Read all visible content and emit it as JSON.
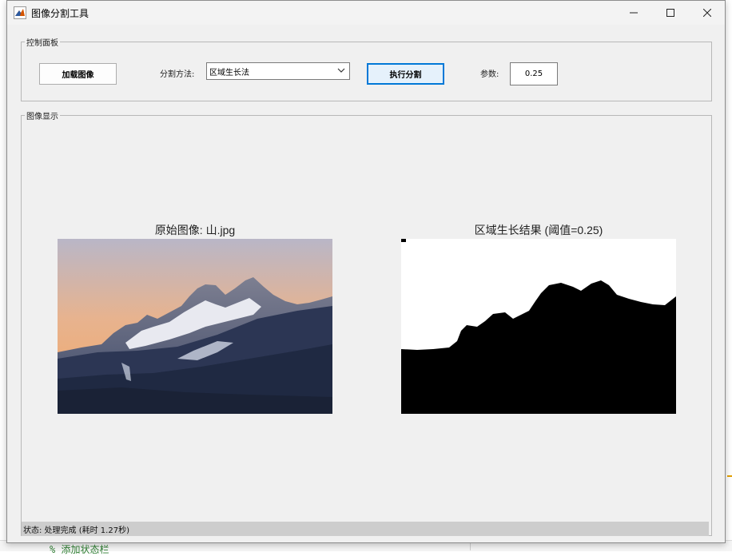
{
  "window": {
    "title": "图像分割工具",
    "minimize_icon": "minimize-icon",
    "maximize_icon": "maximize-icon",
    "close_icon": "close-icon"
  },
  "control_panel": {
    "legend": "控制面板",
    "load_button": "加载图像",
    "method_label": "分割方法:",
    "method_value": "区域生长法",
    "run_button": "执行分割",
    "param_label": "参数:",
    "param_value": "0.25"
  },
  "display_panel": {
    "legend": "图像显示",
    "original_title": "原始图像: 山.jpg",
    "result_title": "区域生长结果 (阈值=0.25)"
  },
  "status": {
    "text": "状态: 处理完成 (耗时 1.27秒)"
  },
  "background": {
    "fragment": "%  添加状态栏"
  },
  "colors": {
    "accent": "#0078d7",
    "panel": "#f0f0f0",
    "status_bg": "#cdcdcd"
  }
}
